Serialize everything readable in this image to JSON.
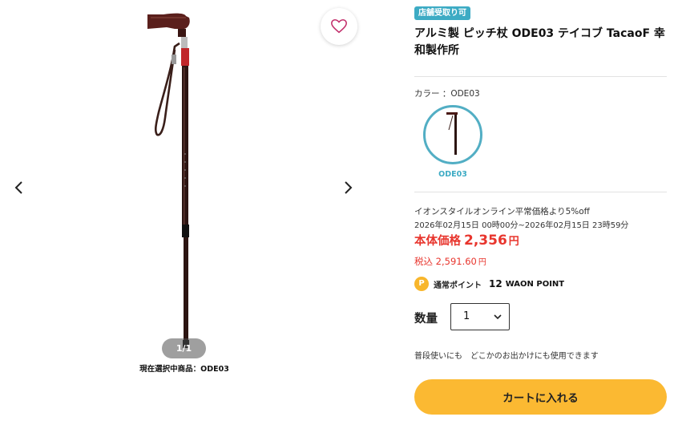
{
  "gallery": {
    "counter": "1/1",
    "selected_caption": "現在選択中商品：ODE03",
    "prev_icon": "chevron-left-icon",
    "next_icon": "chevron-right-icon",
    "favorite_icon": "heart-icon"
  },
  "product": {
    "badge": "店舗受取り可",
    "title": "アルミ製 ピッチ杖 ODE03 テイコブ TacaoF 幸和製作所",
    "color_label": "カラー ：ODE03",
    "swatch_label": "ODE03"
  },
  "sale": {
    "description": "イオンスタイルオンライン平常価格より5%off",
    "period": "2026年02月15日 00時00分~2026年02月15日 23時59分"
  },
  "price": {
    "label": "本体価格",
    "value": "2,356",
    "unit": "円",
    "tax_label": "税込",
    "tax_value": "2,591.60",
    "tax_unit": "円"
  },
  "points": {
    "icon_text": "P",
    "label": "通常ポイント",
    "value": "12",
    "unit": "WAON POINT"
  },
  "quantity": {
    "label": "数量",
    "value": "1"
  },
  "description": "普段使いにも　どこかのお出かけにも使用できます",
  "cart_button": "カートに入れる",
  "colors": {
    "accent": "#3dabc4",
    "price": "#e8352d",
    "cart": "#fbb932",
    "point": "#f8b62c",
    "heart": "#c22d6a"
  }
}
